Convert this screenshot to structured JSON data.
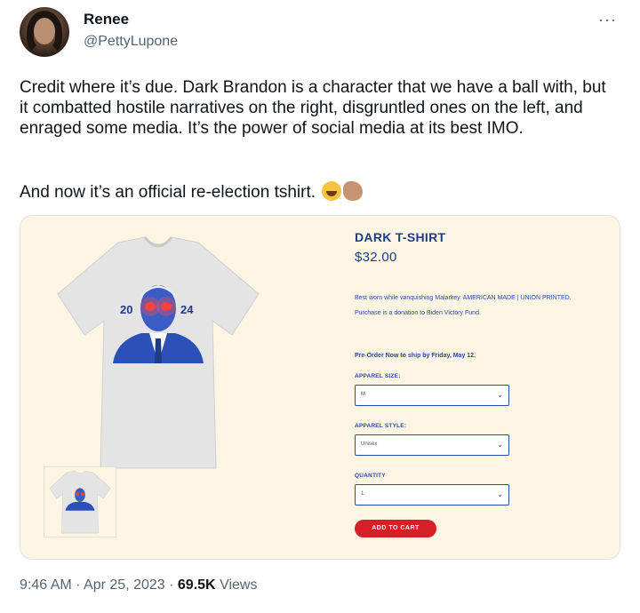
{
  "author": {
    "display_name": "Renee",
    "handle": "@PettyLupone"
  },
  "tweet": {
    "text": "Credit where it’s due. Dark Brandon is a character that we have a ball with, but it combatted hostile narratives on the right, disgruntled ones on the left, and enraged some media. It’s the power of social media at its best IMO.",
    "text2": "And now it’s an official re-election tshirt.",
    "emojis": [
      "rolling-on-floor-laughing-emoji",
      "clapping-hands-emoji"
    ],
    "more_icon": "more-icon"
  },
  "product": {
    "title": "DARK T-SHIRT",
    "price": "$32.00",
    "description": "Best worn while vanquishing Malarkey. AMERICAN MADE | UNION PRINTED. Purchase is a donation to Biden Victory Fund.",
    "preorder": "Pre-Order Now to ship by Friday, May 12.",
    "size_label": "APPAREL SIZE:",
    "size_value": "M",
    "style_label": "APPAREL STYLE:",
    "style_value": "Unisex",
    "quantity_label": "QUANTITY",
    "quantity_value": "1",
    "add_to_cart": "ADD TO CART",
    "shirt_text_left": "20",
    "shirt_text_right": "24"
  },
  "meta": {
    "time": "9:46 AM",
    "date": "Apr 25, 2023",
    "views_count": "69.5K",
    "views_label": "Views",
    "separator": "·"
  },
  "colors": {
    "accent_blue": "#1f3c88",
    "card_bg": "#fcf5e4",
    "cart_red": "#d61f26",
    "muted": "#536471"
  }
}
